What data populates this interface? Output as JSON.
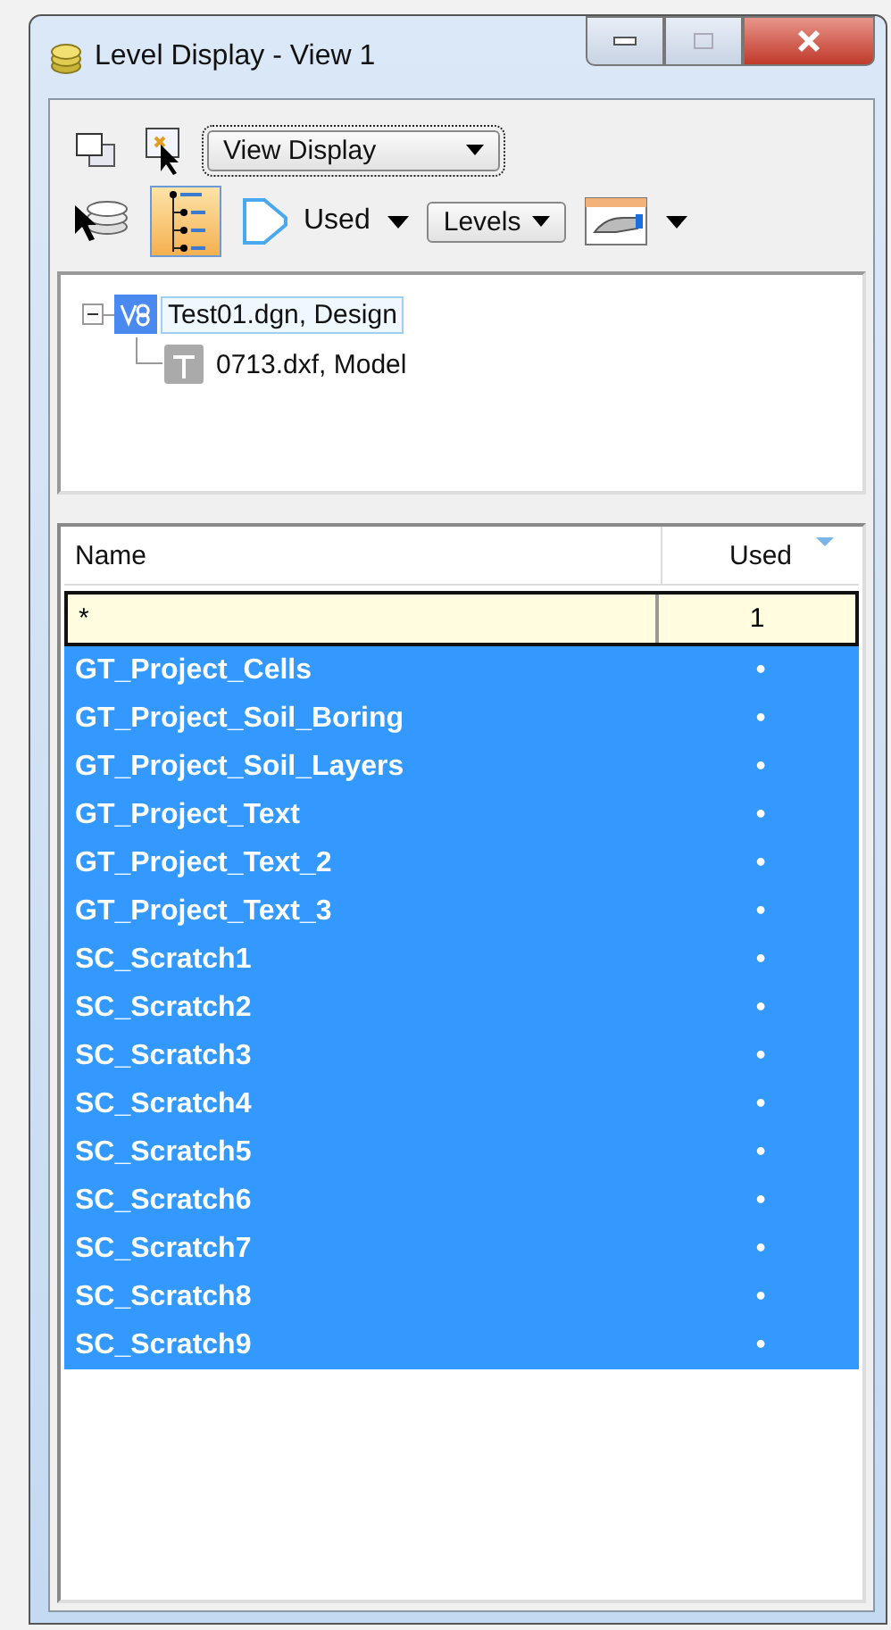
{
  "window": {
    "title": "Level Display - View 1",
    "buttons": [
      {
        "kind": "minimize"
      },
      {
        "kind": "maximize"
      },
      {
        "kind": "close"
      }
    ]
  },
  "toolbar_1": {
    "view_dropdown": "View Display"
  },
  "toolbar_2": {
    "hierarchy_on": true,
    "filter_label": "Used",
    "levels_dropdown": "Levels"
  },
  "tree": [
    {
      "label": "Test01.dgn, Design",
      "selected": true,
      "expanded": true,
      "children": [
        {
          "label": "0713.dxf, Model",
          "selected": false
        }
      ]
    }
  ],
  "table": {
    "columns": [
      "Name",
      "Used"
    ],
    "filter_row": [
      "*",
      "1"
    ],
    "rows": [
      {
        "name": "GT_Project_Cells",
        "used": "•",
        "selected": true
      },
      {
        "name": "GT_Project_Soil_Boring",
        "used": "•",
        "selected": true
      },
      {
        "name": "GT_Project_Soil_Layers",
        "used": "•",
        "selected": true
      },
      {
        "name": "GT_Project_Text",
        "used": "•",
        "selected": true
      },
      {
        "name": "GT_Project_Text_2",
        "used": "•",
        "selected": true
      },
      {
        "name": "GT_Project_Text_3",
        "used": "•",
        "selected": true
      },
      {
        "name": "SC_Scratch1",
        "used": "•",
        "selected": true
      },
      {
        "name": "SC_Scratch2",
        "used": "•",
        "selected": true
      },
      {
        "name": "SC_Scratch3",
        "used": "•",
        "selected": true
      },
      {
        "name": "SC_Scratch4",
        "used": "•",
        "selected": true
      },
      {
        "name": "SC_Scratch5",
        "used": "•",
        "selected": true
      },
      {
        "name": "SC_Scratch6",
        "used": "•",
        "selected": true
      },
      {
        "name": "SC_Scratch7",
        "used": "•",
        "selected": true
      },
      {
        "name": "SC_Scratch8",
        "used": "•",
        "selected": true
      },
      {
        "name": "SC_Scratch9",
        "used": "•",
        "selected": true
      }
    ]
  }
}
